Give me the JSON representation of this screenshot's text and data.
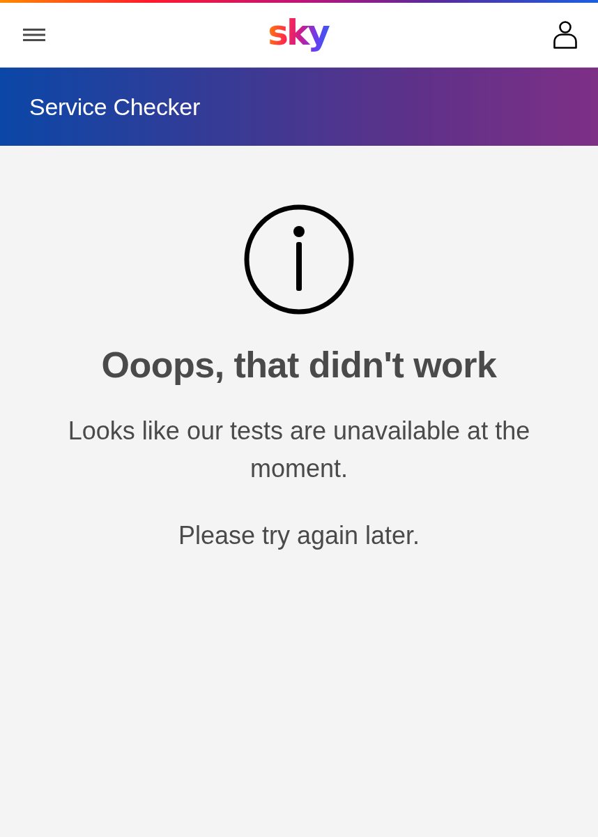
{
  "header": {
    "logo": "sky"
  },
  "banner": {
    "title": "Service Checker"
  },
  "message": {
    "heading": "Ooops, that didn't work",
    "paragraphs": [
      "Looks like our tests are unavailable at the moment.",
      "Please try again later."
    ]
  }
}
